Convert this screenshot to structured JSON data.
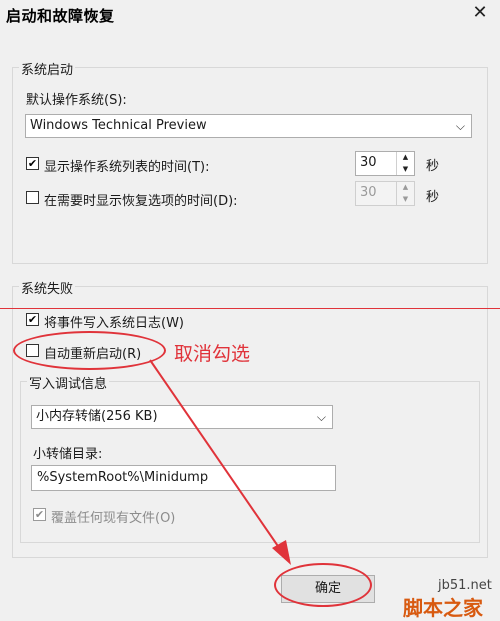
{
  "window": {
    "title": "启动和故障恢复",
    "close_glyph": "✕"
  },
  "system_startup": {
    "group_label": "系统启动",
    "default_os_label": "默认操作系统(S):",
    "default_os_value": "Windows Technical Preview",
    "show_list_label": "显示操作系统列表的时间(T):",
    "show_list_checked": true,
    "show_list_value": "30",
    "show_recovery_label": "在需要时显示恢复选项的时间(D):",
    "show_recovery_checked": false,
    "show_recovery_value": "30",
    "unit": "秒"
  },
  "system_failure": {
    "group_label": "系统失败",
    "write_event_label": "将事件写入系统日志(W)",
    "write_event_checked": true,
    "auto_restart_label": "自动重新启动(R)",
    "auto_restart_checked": false,
    "debug_group_label": "写入调试信息",
    "debug_type_value": "小内存转储(256 KB)",
    "dump_dir_label": "小转储目录:",
    "dump_dir_value": "%SystemRoot%\\Minidump",
    "overwrite_label": "覆盖任何现有文件(O)",
    "overwrite_checked": true
  },
  "buttons": {
    "ok": "确定"
  },
  "annotation": {
    "text": "取消勾选",
    "color": "#e0333a"
  },
  "watermark": {
    "line1": "jb51.net",
    "line2": "脚本之家"
  },
  "icons": {
    "check": "✔",
    "chevron": "⌵",
    "spin_up": "▲",
    "spin_down": "▼"
  }
}
